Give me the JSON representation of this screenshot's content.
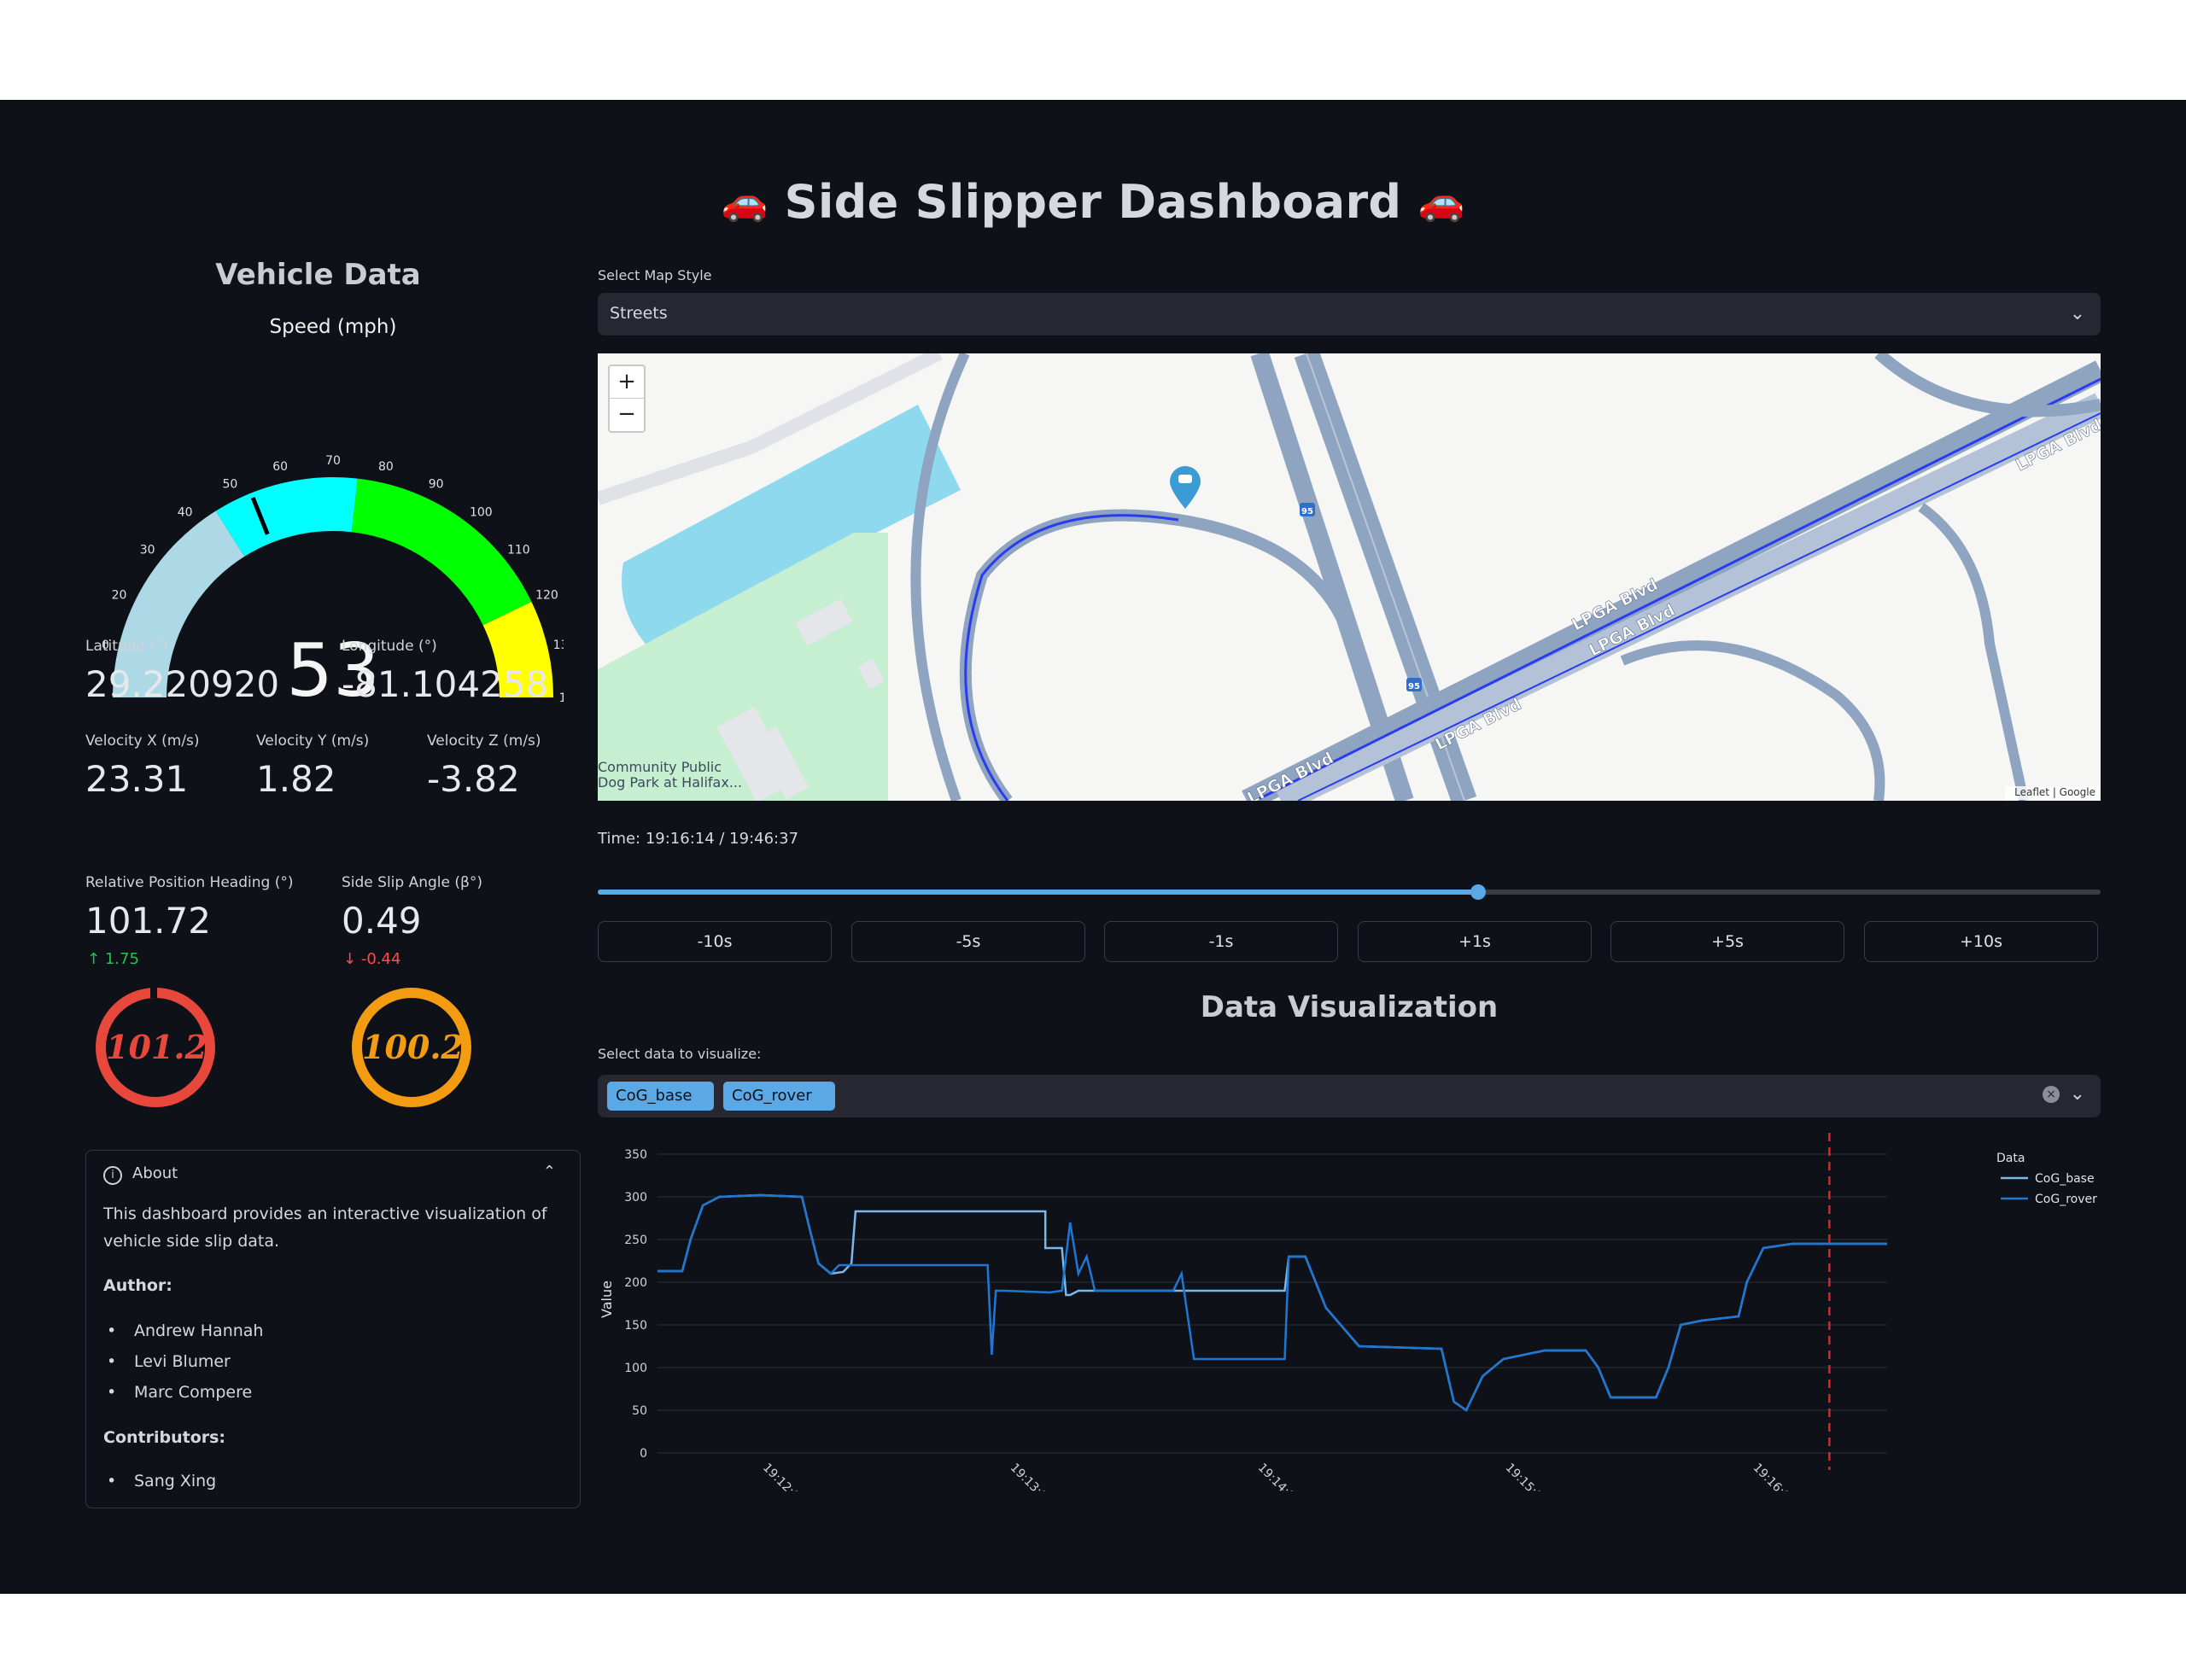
{
  "app": {
    "title": "Side Slipper Dashboard",
    "title_icon_left": "🚗",
    "title_icon_right": "🚗"
  },
  "vehicle": {
    "section_title": "Vehicle Data",
    "gauge": {
      "title": "Speed (mph)",
      "value": 53,
      "value_text": "53",
      "min": 0,
      "max": 140,
      "ticks": [
        "0",
        "10",
        "20",
        "30",
        "40",
        "50",
        "60",
        "70",
        "80",
        "90",
        "100",
        "110",
        "120",
        "130",
        "140"
      ],
      "bands": [
        {
          "from": 0,
          "to": 45,
          "color": "#add8e6"
        },
        {
          "from": 45,
          "to": 75,
          "color": "#00ffff"
        },
        {
          "from": 75,
          "to": 120,
          "color": "#00ff00"
        },
        {
          "from": 120,
          "to": 140,
          "color": "#ffff00"
        }
      ],
      "needle_value": 53
    },
    "latitude": {
      "label": "Latitude (°)",
      "value": "29.220920"
    },
    "longitude": {
      "label": "Longitude (°)",
      "value": "-81.104258"
    },
    "vx": {
      "label": "Velocity X (m/s)",
      "value": "23.31"
    },
    "vy": {
      "label": "Velocity Y (m/s)",
      "value": "1.82"
    },
    "vz": {
      "label": "Velocity Z (m/s)",
      "value": "-3.82"
    },
    "heading": {
      "label": "Relative Position Heading (°)",
      "value": "101.72",
      "delta": "1.75",
      "delta_icon": "arrow-up-icon",
      "delta_color": "#21c354"
    },
    "slip": {
      "label": "Side Slip Angle (β°)",
      "value": "0.49",
      "delta": "-0.44",
      "delta_icon": "arrow-down-icon",
      "delta_color": "#ff4b4b"
    },
    "ring_heading": {
      "value": "101.2",
      "color": "#e8473c"
    },
    "ring_slip": {
      "value": "100.2",
      "color": "#f39c12"
    }
  },
  "about": {
    "header": "About",
    "header_icon": "info-icon",
    "description": "This dashboard provides an interactive visualization of vehicle side slip data.",
    "author_label": "Author:",
    "authors": [
      "Andrew Hannah",
      "Levi Blumer",
      "Marc Compere"
    ],
    "contributors_label": "Contributors:",
    "contributors": [
      "Sang Xing"
    ]
  },
  "map": {
    "style_label": "Select Map Style",
    "style_value": "Streets",
    "zoom_in": "+",
    "zoom_out": "−",
    "attribution": "Leaflet | Google",
    "labels": {
      "road1": "LPGA Blvd",
      "road2": "LPGA Blvd",
      "road3": "LPGA Blvd",
      "road4": "LPGA Blvd",
      "road5": "LPGA Blvd",
      "poi": "Community Public Dog Park at Halifax...",
      "shield": "95"
    }
  },
  "time": {
    "text": "Time: 19:16:14 / 19:46:37",
    "slider_fraction": 0.586
  },
  "steps": [
    "-10s",
    "-5s",
    "-1s",
    "+1s",
    "+5s",
    "+10s"
  ],
  "viz": {
    "title": "Data Visualization",
    "select_label": "Select data to visualize:",
    "tags": [
      "CoG_base",
      "CoG_rover"
    ],
    "tag_close": "×"
  },
  "chart_data": {
    "type": "line",
    "xlabel": "Time",
    "ylabel": "Value",
    "ylim": [
      0,
      360
    ],
    "xlim": [
      "19:11:30",
      "19:16:28"
    ],
    "yticks": [
      0,
      50,
      100,
      150,
      200,
      250,
      300,
      350
    ],
    "xticks": [
      "19:12:00",
      "19:13:00",
      "19:14:00",
      "19:15:00",
      "19:16:00"
    ],
    "legend_title": "Data",
    "legend_position": "top-right",
    "grid": true,
    "marker_line": {
      "x": "19:16:14",
      "color": "#e02424",
      "style": "dashed"
    },
    "series": [
      {
        "name": "CoG_base",
        "color": "#7ab8ec",
        "points": [
          [
            "19:11:30",
            213
          ],
          [
            "19:11:36",
            213
          ],
          [
            "19:11:38",
            250
          ],
          [
            "19:11:41",
            290
          ],
          [
            "19:11:45",
            300
          ],
          [
            "19:11:55",
            302
          ],
          [
            "19:12:05",
            300
          ],
          [
            "19:12:07",
            260
          ],
          [
            "19:12:09",
            222
          ],
          [
            "19:12:12",
            210
          ],
          [
            "19:12:15",
            212
          ],
          [
            "19:12:17",
            222
          ],
          [
            "19:12:18",
            283
          ],
          [
            "19:12:40",
            283
          ],
          [
            "19:13:00",
            283
          ],
          [
            "19:13:04",
            283
          ],
          [
            "19:13:04",
            240
          ],
          [
            "19:13:08",
            240
          ],
          [
            "19:13:09",
            185
          ],
          [
            "19:13:10",
            185
          ],
          [
            "19:13:12",
            190
          ],
          [
            "19:13:40",
            190
          ],
          [
            "19:14:00",
            190
          ],
          [
            "19:14:02",
            190
          ],
          [
            "19:14:03",
            230
          ],
          [
            "19:14:07",
            230
          ],
          [
            "19:14:12",
            170
          ],
          [
            "19:14:20",
            125
          ],
          [
            "19:14:40",
            122
          ],
          [
            "19:14:43",
            60
          ],
          [
            "19:14:46",
            50
          ],
          [
            "19:14:50",
            90
          ],
          [
            "19:14:55",
            110
          ],
          [
            "19:15:05",
            120
          ],
          [
            "19:15:15",
            120
          ],
          [
            "19:15:18",
            100
          ],
          [
            "19:15:21",
            65
          ],
          [
            "19:15:32",
            65
          ],
          [
            "19:15:35",
            100
          ],
          [
            "19:15:38",
            150
          ],
          [
            "19:15:43",
            155
          ],
          [
            "19:15:52",
            160
          ],
          [
            "19:15:54",
            200
          ],
          [
            "19:15:58",
            240
          ],
          [
            "19:16:05",
            245
          ],
          [
            "19:16:30",
            245
          ],
          [
            "19:16:45",
            245
          ],
          [
            "19:16:50",
            248
          ],
          [
            "19:16:55",
            320
          ]
        ]
      },
      {
        "name": "CoG_rover",
        "color": "#1f77d4",
        "points": [
          [
            "19:11:30",
            213
          ],
          [
            "19:11:36",
            213
          ],
          [
            "19:11:38",
            250
          ],
          [
            "19:11:41",
            290
          ],
          [
            "19:11:45",
            300
          ],
          [
            "19:11:55",
            302
          ],
          [
            "19:12:05",
            300
          ],
          [
            "19:12:07",
            260
          ],
          [
            "19:12:09",
            222
          ],
          [
            "19:12:12",
            210
          ],
          [
            "19:12:14",
            220
          ],
          [
            "19:12:50",
            220
          ],
          [
            "19:12:51",
            115
          ],
          [
            "19:12:52",
            190
          ],
          [
            "19:12:54",
            190
          ],
          [
            "19:13:05",
            188
          ],
          [
            "19:13:08",
            190
          ],
          [
            "19:13:10",
            270
          ],
          [
            "19:13:12",
            210
          ],
          [
            "19:13:14",
            230
          ],
          [
            "19:13:16",
            190
          ],
          [
            "19:13:35",
            190
          ],
          [
            "19:13:37",
            210
          ],
          [
            "19:13:40",
            110
          ],
          [
            "19:14:00",
            110
          ],
          [
            "19:14:02",
            110
          ],
          [
            "19:14:03",
            230
          ],
          [
            "19:14:07",
            230
          ],
          [
            "19:14:12",
            170
          ],
          [
            "19:14:20",
            125
          ],
          [
            "19:14:40",
            122
          ],
          [
            "19:14:43",
            60
          ],
          [
            "19:14:46",
            50
          ],
          [
            "19:14:50",
            90
          ],
          [
            "19:14:55",
            110
          ],
          [
            "19:15:05",
            120
          ],
          [
            "19:15:15",
            120
          ],
          [
            "19:15:18",
            100
          ],
          [
            "19:15:21",
            65
          ],
          [
            "19:15:32",
            65
          ],
          [
            "19:15:35",
            100
          ],
          [
            "19:15:38",
            150
          ],
          [
            "19:15:43",
            155
          ],
          [
            "19:15:52",
            160
          ],
          [
            "19:15:54",
            200
          ],
          [
            "19:15:58",
            240
          ],
          [
            "19:16:05",
            245
          ],
          [
            "19:16:30",
            245
          ],
          [
            "19:16:45",
            245
          ],
          [
            "19:16:50",
            248
          ],
          [
            "19:16:55",
            320
          ]
        ]
      }
    ]
  }
}
